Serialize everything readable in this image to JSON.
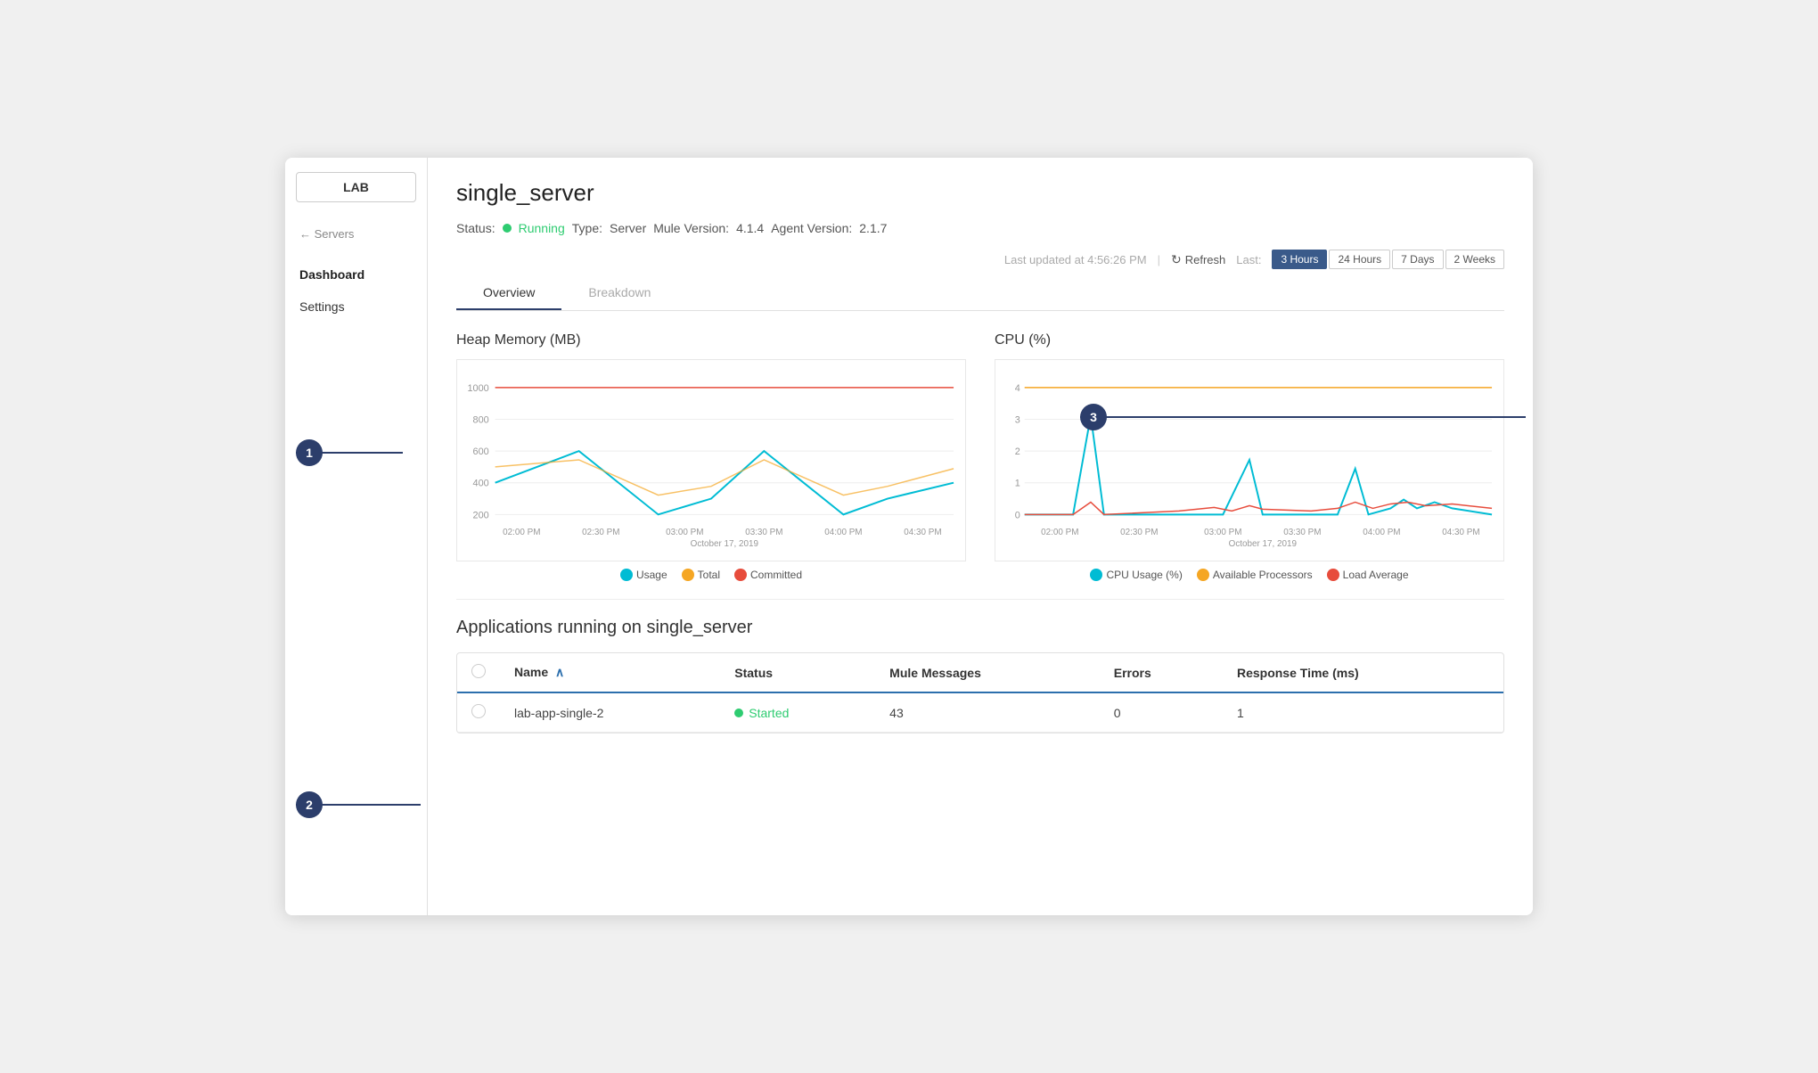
{
  "sidebar": {
    "logo": "LAB",
    "back_label": "← Servers",
    "nav_items": [
      {
        "label": "Dashboard",
        "active": true
      },
      {
        "label": "Settings",
        "active": false
      }
    ]
  },
  "header": {
    "title": "single_server",
    "status_label": "Status:",
    "status_value": "Running",
    "type_label": "Type:",
    "type_value": "Server",
    "mule_label": "Mule Version:",
    "mule_value": "4.1.4",
    "agent_label": "Agent Version:",
    "agent_value": "2.1.7"
  },
  "toolbar": {
    "last_updated": "Last updated at 4:56:26 PM",
    "refresh_label": "Refresh",
    "last_label": "Last:",
    "time_options": [
      {
        "label": "3 Hours",
        "active": true
      },
      {
        "label": "24 Hours",
        "active": false
      },
      {
        "label": "7 Days",
        "active": false
      },
      {
        "label": "2 Weeks",
        "active": false
      }
    ]
  },
  "tabs": [
    {
      "label": "Overview",
      "active": true
    },
    {
      "label": "Breakdown",
      "active": false
    }
  ],
  "heap_chart": {
    "title": "Heap Memory (MB)",
    "date_label": "October 17, 2019",
    "y_labels": [
      "1000",
      "800",
      "600",
      "400",
      "200"
    ],
    "x_labels": [
      "02:00 PM",
      "02:30 PM",
      "03:00 PM",
      "03:30 PM",
      "04:00 PM",
      "04:30 PM"
    ],
    "legend": [
      {
        "label": "Usage",
        "color": "#00bcd4"
      },
      {
        "label": "Total",
        "color": "#f5a623"
      },
      {
        "label": "Committed",
        "color": "#e74c3c"
      }
    ]
  },
  "cpu_chart": {
    "title": "CPU (%)",
    "date_label": "October 17, 2019",
    "y_labels": [
      "4",
      "3",
      "2",
      "1",
      "0"
    ],
    "x_labels": [
      "02:00 PM",
      "02:30 PM",
      "03:00 PM",
      "03:30 PM",
      "04:00 PM",
      "04:30 PM"
    ],
    "legend": [
      {
        "label": "CPU Usage (%)",
        "color": "#00bcd4"
      },
      {
        "label": "Available Processors",
        "color": "#f5a623"
      },
      {
        "label": "Load Average",
        "color": "#e74c3c"
      }
    ]
  },
  "applications": {
    "section_title": "Applications running on single_server",
    "columns": [
      "Name",
      "Status",
      "Mule Messages",
      "Errors",
      "Response Time (ms)"
    ],
    "rows": [
      {
        "name": "lab-app-single-2",
        "status": "Started",
        "mule_messages": "43",
        "errors": "0",
        "response_time": "1"
      }
    ]
  },
  "callouts": [
    {
      "number": "1"
    },
    {
      "number": "2"
    },
    {
      "number": "3"
    }
  ],
  "colors": {
    "accent_blue": "#2c3e6b",
    "running_green": "#2ecc71",
    "usage_cyan": "#00bcd4",
    "total_yellow": "#f5a623",
    "committed_red": "#e74c3c"
  }
}
